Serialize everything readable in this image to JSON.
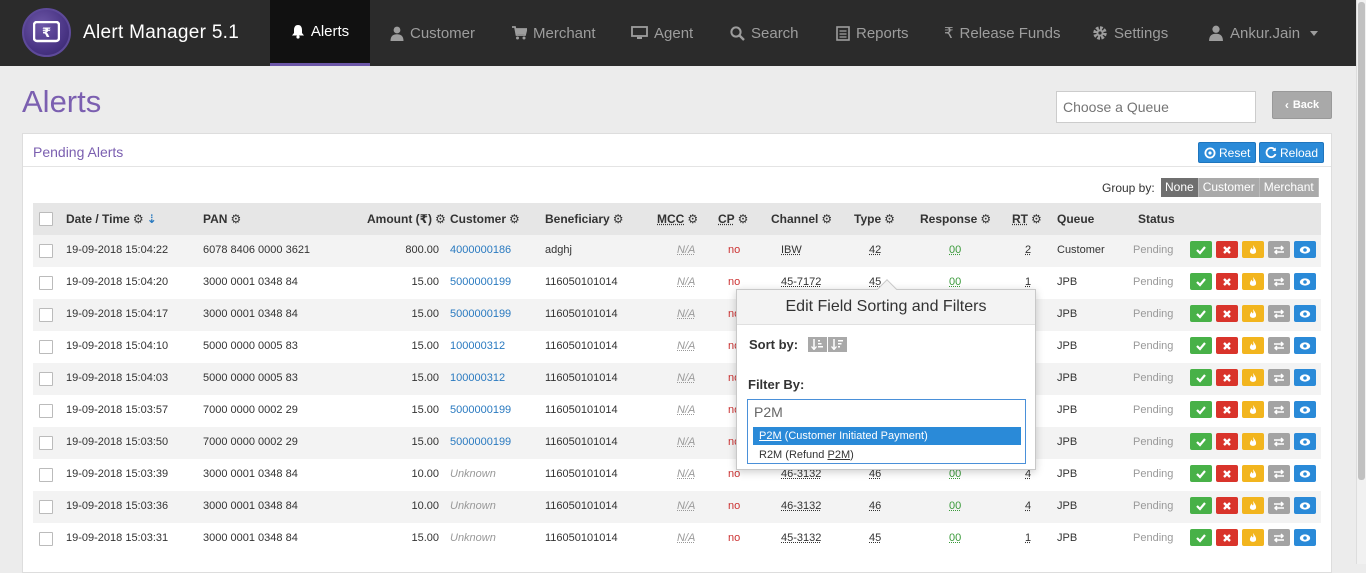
{
  "app": {
    "title": "Alert Manager 5.1"
  },
  "nav": [
    {
      "label": "Alerts",
      "icon": "bell-icon",
      "active": true
    },
    {
      "label": "Customer",
      "icon": "user-icon"
    },
    {
      "label": "Merchant",
      "icon": "cart-icon"
    },
    {
      "label": "Agent",
      "icon": "monitor-icon"
    },
    {
      "label": "Search",
      "icon": "search-icon"
    },
    {
      "label": "Reports",
      "icon": "report-icon"
    },
    {
      "label": "Release Funds",
      "icon": "rupee-icon"
    },
    {
      "label": "Settings",
      "icon": "gear-icon"
    },
    {
      "label": "Ankur.Jain",
      "icon": "user-icon"
    }
  ],
  "page": {
    "title": "Alerts",
    "queue_placeholder": "Choose a Queue",
    "back_label": "Back"
  },
  "panel": {
    "title": "Pending Alerts",
    "reset_label": "Reset",
    "reload_label": "Reload",
    "groupby_label": "Group by:",
    "groupby_options": [
      "None",
      "Customer",
      "Merchant"
    ],
    "groupby_selected": "None"
  },
  "table": {
    "headers": {
      "datetime": "Date / Time",
      "pan": "PAN",
      "amount": "Amount (₹)",
      "customer": "Customer",
      "beneficiary": "Beneficiary",
      "mcc": "MCC",
      "cp": "CP",
      "channel": "Channel",
      "type": "Type",
      "response": "Response",
      "rt": "RT",
      "queue": "Queue",
      "status": "Status"
    },
    "rows": [
      {
        "datetime": "19-09-2018 15:04:22",
        "pan": "6078 8406 0000 3621",
        "amount": "800.00",
        "customer": "4000000186",
        "beneficiary": "adghj",
        "mcc": "N/A",
        "cp": "no",
        "channel": "IBW",
        "type": "42",
        "response": "00",
        "rt": "2",
        "queue": "Customer",
        "status": "Pending"
      },
      {
        "datetime": "19-09-2018 15:04:20",
        "pan": "3000 0001 0348 84",
        "amount": "15.00",
        "customer": "5000000199",
        "beneficiary": "116050101014",
        "mcc": "N/A",
        "cp": "no",
        "channel": "45-7172",
        "type": "45",
        "response": "00",
        "rt": "1",
        "queue": "JPB",
        "status": "Pending"
      },
      {
        "datetime": "19-09-2018 15:04:17",
        "pan": "3000 0001 0348 84",
        "amount": "15.00",
        "customer": "5000000199",
        "beneficiary": "116050101014",
        "mcc": "N/A",
        "cp": "no",
        "channel": "",
        "type": "",
        "response": "",
        "rt": "",
        "queue": "JPB",
        "status": "Pending"
      },
      {
        "datetime": "19-09-2018 15:04:10",
        "pan": "5000 0000 0005 83",
        "amount": "15.00",
        "customer": "100000312",
        "beneficiary": "116050101014",
        "mcc": "N/A",
        "cp": "no",
        "channel": "",
        "type": "",
        "response": "",
        "rt": "",
        "queue": "JPB",
        "status": "Pending"
      },
      {
        "datetime": "19-09-2018 15:04:03",
        "pan": "5000 0000 0005 83",
        "amount": "15.00",
        "customer": "100000312",
        "beneficiary": "116050101014",
        "mcc": "N/A",
        "cp": "no",
        "channel": "",
        "type": "",
        "response": "",
        "rt": "",
        "queue": "JPB",
        "status": "Pending"
      },
      {
        "datetime": "19-09-2018 15:03:57",
        "pan": "7000 0000 0002 29",
        "amount": "15.00",
        "customer": "5000000199",
        "beneficiary": "116050101014",
        "mcc": "N/A",
        "cp": "no",
        "channel": "",
        "type": "",
        "response": "",
        "rt": "",
        "queue": "JPB",
        "status": "Pending"
      },
      {
        "datetime": "19-09-2018 15:03:50",
        "pan": "7000 0000 0002 29",
        "amount": "15.00",
        "customer": "5000000199",
        "beneficiary": "116050101014",
        "mcc": "N/A",
        "cp": "no",
        "channel": "",
        "type": "",
        "response": "",
        "rt": "",
        "queue": "JPB",
        "status": "Pending"
      },
      {
        "datetime": "19-09-2018 15:03:39",
        "pan": "3000 0001 0348 84",
        "amount": "10.00",
        "customer": "Unknown",
        "beneficiary": "116050101014",
        "mcc": "N/A",
        "cp": "no",
        "channel": "46-3132",
        "type": "46",
        "response": "00",
        "rt": "4",
        "queue": "JPB",
        "status": "Pending"
      },
      {
        "datetime": "19-09-2018 15:03:36",
        "pan": "3000 0001 0348 84",
        "amount": "10.00",
        "customer": "Unknown",
        "beneficiary": "116050101014",
        "mcc": "N/A",
        "cp": "no",
        "channel": "46-3132",
        "type": "46",
        "response": "00",
        "rt": "4",
        "queue": "JPB",
        "status": "Pending"
      },
      {
        "datetime": "19-09-2018 15:03:31",
        "pan": "3000 0001 0348 84",
        "amount": "15.00",
        "customer": "Unknown",
        "beneficiary": "116050101014",
        "mcc": "N/A",
        "cp": "no",
        "channel": "45-3132",
        "type": "45",
        "response": "00",
        "rt": "1",
        "queue": "JPB",
        "status": "Pending"
      }
    ]
  },
  "popover": {
    "title": "Edit Field Sorting and Filters",
    "sort_label": "Sort by:",
    "filter_label": "Filter By:",
    "filter_value": "P2M",
    "options": [
      {
        "match": "P2M",
        "rest": " (Customer Initiated Payment)",
        "selected": true
      },
      {
        "prefix": "R2M (Refund ",
        "match": "P2M",
        "suffix": ")",
        "selected": false
      }
    ]
  },
  "colors": {
    "accent": "#7b5fb0",
    "nav_bg": "#2b2b2b",
    "primary_btn": "#2a8ad8"
  }
}
